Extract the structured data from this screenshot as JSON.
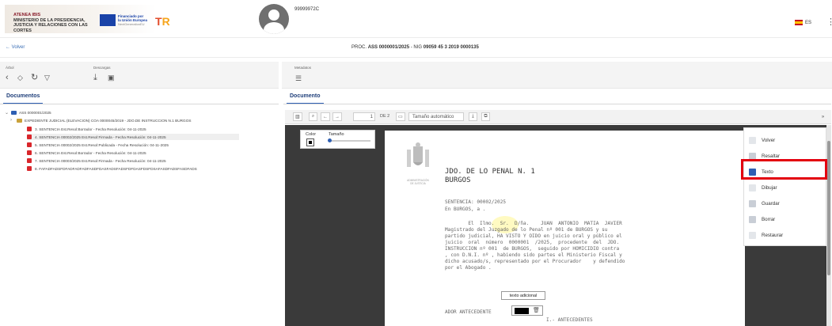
{
  "header": {
    "org_line1": "ATENEA IBIS",
    "org_line2": "MINISTERIO DE LA PRESIDENCIA,",
    "org_line3": "JUSTICIA Y RELACIONES CON LAS",
    "org_line4": "CORTES",
    "eu_line1": "Financiado por",
    "eu_line2": "la Unión Europea",
    "eu_line3": "NextGenerationEU",
    "prtr_r": "T",
    "prtr_t": "R",
    "user_id": "99999972C",
    "lang": "ES"
  },
  "subheader": {
    "back_label": "← Volver",
    "proc_prefix": "PROC.",
    "proc_code": "ASS 0000001/2025",
    "nig_prefix": "- NIG",
    "nig_code": "09059 45 3 2019 0000135"
  },
  "toolbar_left": {
    "arbol_label": "Árbol",
    "descargas_label": "Descargas"
  },
  "toolbar_right": {
    "metadatos_label": "Metadatos"
  },
  "tabs": {
    "left": "Documentos",
    "right": "Documento"
  },
  "tree": {
    "root": "ASS 0000001/2025",
    "folder": "EXPEDIENTE JUDICIAL (ELEVACION) COA 0000045/2019 - JDO.DE INSTRUCCION N.1 BURGOS",
    "items": [
      "3. SENTENCIA Est.Resol:Borrador - Fecha Resolución: 04-11-2025",
      "4. SENTENCIA 00002/2025 Est.Resol:Firmada - Fecha Resolución: 04-11-2025",
      "5. SENTENCIA 00002/2025 Est.Resol:Publicada - Fecha Resolución: 04-11-2025",
      "6. SENTENCIA Est.Resol:Borrador - Fecha Resolución: 04-11-2025",
      "7. SENTENCIA 00003/2025 Est.Resol:Firmada - Fecha Resolución: 04-11-2025",
      "8. FAFADFADSFDFADFADFADFASDFDASFADSFADSFDFDASFDSFDSAFASDFADSFASDFADS"
    ],
    "selected_index": 1
  },
  "viewer": {
    "page_number": "1",
    "page_total": "DE 2",
    "zoom": "Tamaño automático",
    "color_label": "Color",
    "size_label": "Tamaño"
  },
  "document": {
    "court_caption_line1": "ADMINISTRACIÓN",
    "court_caption_line2": "DE JUSTICIA",
    "court_line1": "JDO. DE LO PENAL N. 1",
    "court_line2": "BURGOS",
    "sentencia": "SENTENCIA: 00002/2025",
    "lugar": "En BURGOS, a .",
    "body_lines": [
      "        El  Ilmo.  Sr.  D/ña.    JUAN  ANTONIO  MATIA  JAVIER",
      "Magistrado del Juzgado de lo Penal nº 001 de BURGOS y su",
      "partido judicial, HA VISTO Y OIDO en juicio oral y público el",
      "juicio  oral  número  0000001  /2025,  procedente  del  JDO.",
      "INSTRUCCION nº 001  de BURGOS,  seguido por HOMICIDIO contra",
      ", con D.N.I. nº , habiendo sido partes el Ministerio Fiscal y",
      "dicho acusado/s, representado por el Procurador    y defendido",
      "por el Abogado ."
    ],
    "added_text": "texto adicional",
    "antecedentes_prefix": "ADOR ANTECEDENTE",
    "antecedentes_heading": "I.- ANTECEDENTES"
  },
  "side_menu": {
    "items": [
      "Volver",
      "Resaltar",
      "Texto",
      "Dibujar",
      "Guardar",
      "Borrar",
      "Restaurar"
    ],
    "highlighted": "Texto"
  },
  "colors": {
    "accent": "#2e5fb3",
    "highlight_box": "#e3000f",
    "pdf_icon": "#d9262b",
    "viewer_bg": "#3a3a3a"
  }
}
